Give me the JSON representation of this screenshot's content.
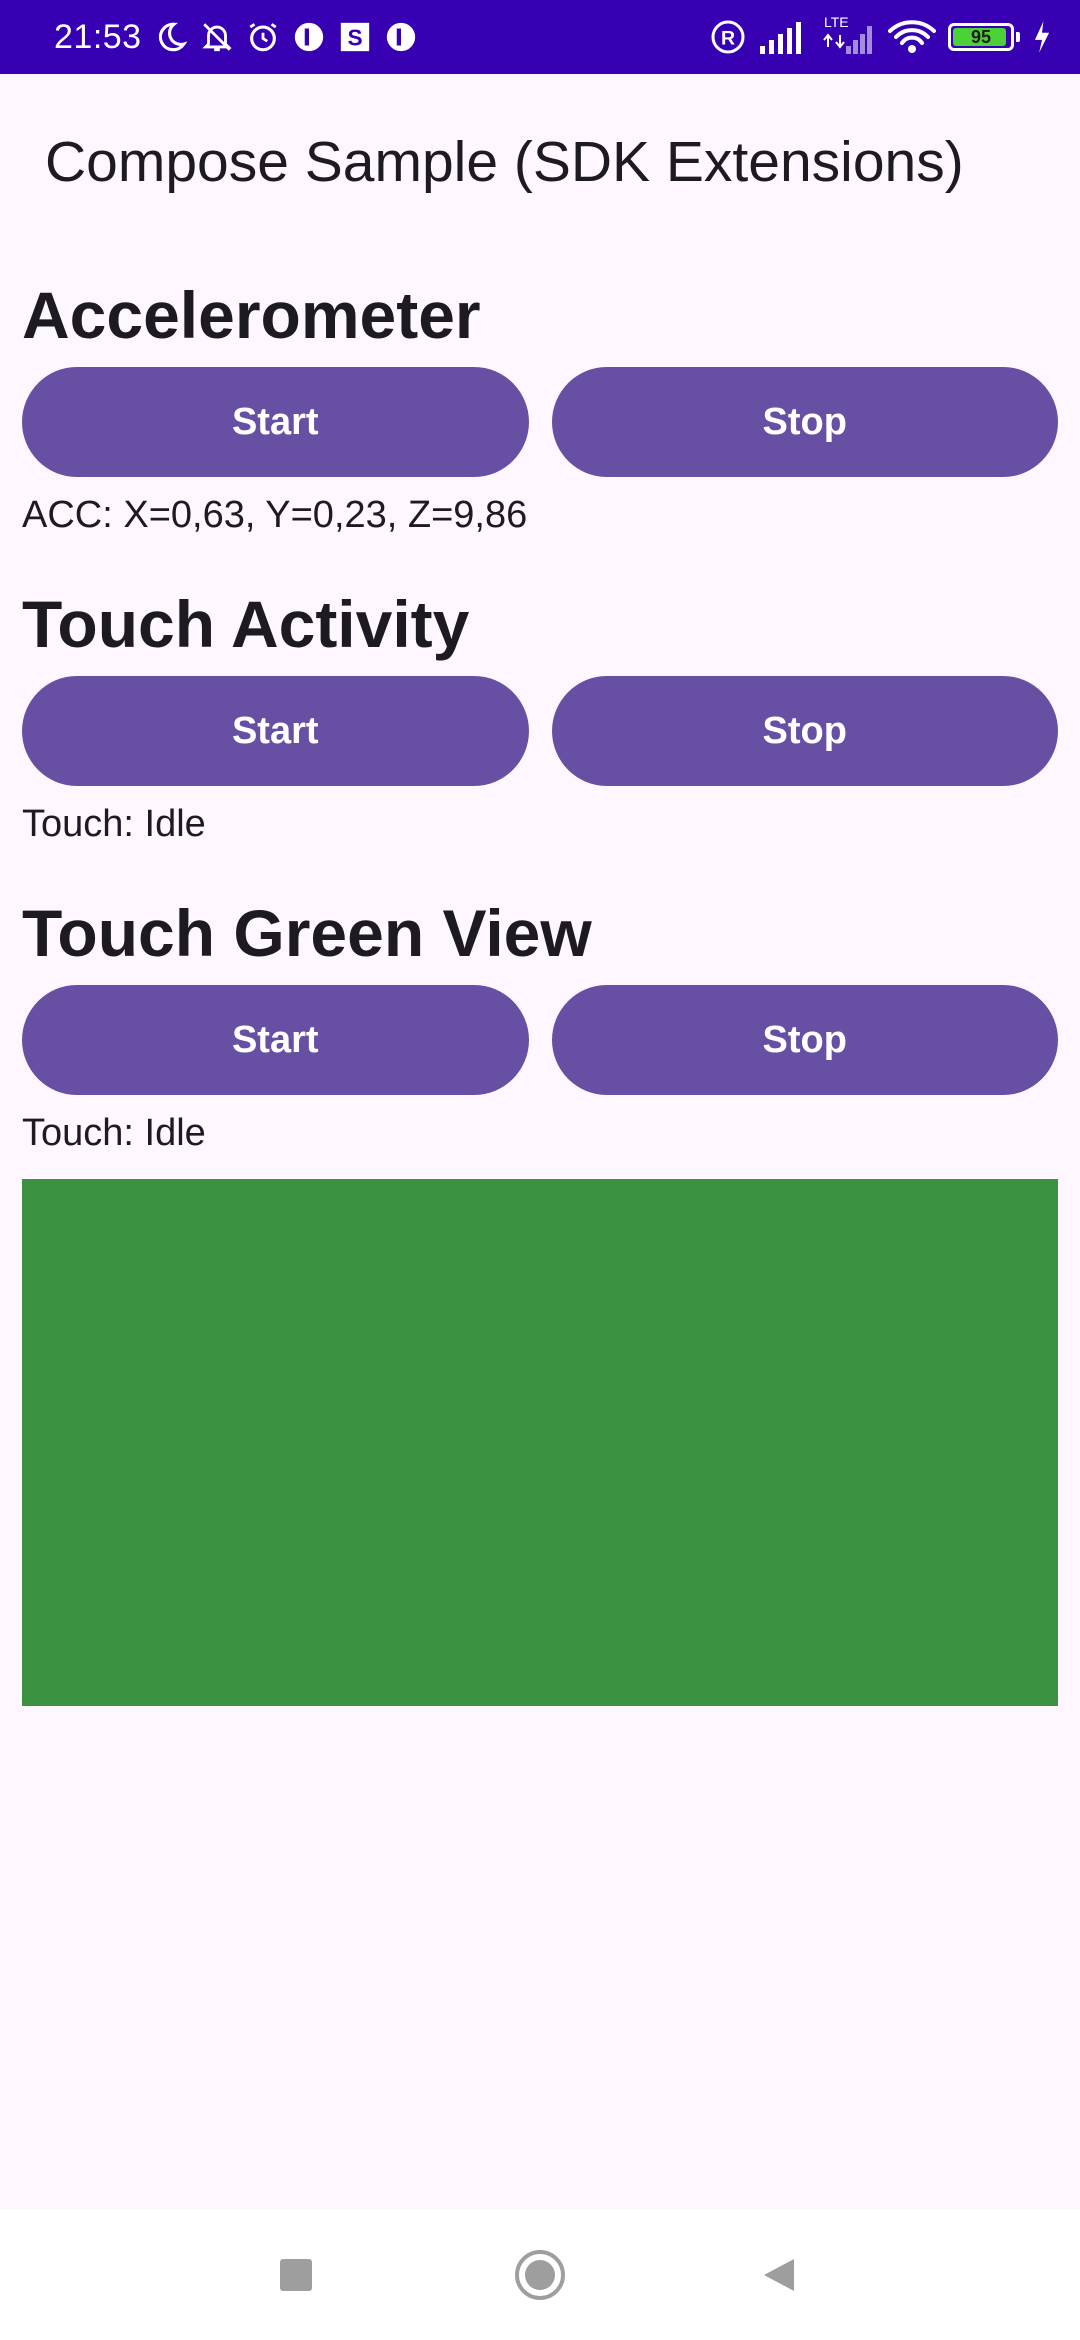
{
  "status_bar": {
    "time": "21:53",
    "notification_icons": [
      "moon-icon",
      "bell-off-icon",
      "alarm-icon",
      "app-icon",
      "s-icon",
      "app-icon"
    ],
    "right_icons": [
      "registered-icon",
      "signal-icon",
      "lte-signal-icon",
      "wifi-icon"
    ],
    "lte_label": "LTE",
    "battery_level": 95,
    "battery_text": "95",
    "background_color": "#3700B3"
  },
  "app_bar": {
    "title": "Compose Sample (SDK Extensions)"
  },
  "colors": {
    "background": "#FEF7FF",
    "button": "#6750A4",
    "button_text": "#FFFFFF",
    "green_view": "#3A913F"
  },
  "sections": {
    "accelerometer": {
      "title": "Accelerometer",
      "start_label": "Start",
      "stop_label": "Stop",
      "status": "ACC: X=0,63, Y=0,23, Z=9,86"
    },
    "touch_activity": {
      "title": "Touch Activity",
      "start_label": "Start",
      "stop_label": "Stop",
      "status": "Touch: Idle"
    },
    "touch_green_view": {
      "title": "Touch Green View",
      "start_label": "Start",
      "stop_label": "Stop",
      "status": "Touch: Idle"
    }
  },
  "nav_bar": {
    "buttons": [
      "recents-icon",
      "home-icon",
      "back-icon"
    ]
  }
}
